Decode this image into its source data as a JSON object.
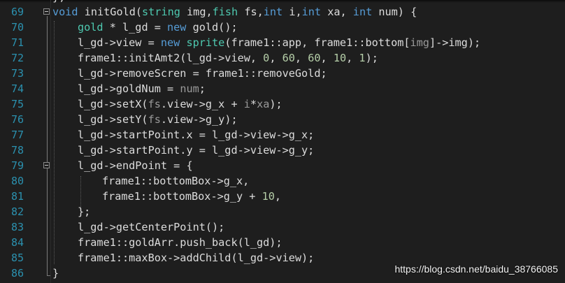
{
  "colors": {
    "background": "#1e1e1e",
    "line_number": "#2b91af",
    "keyword": "#569cd6",
    "type": "#4ec9b0",
    "identifier": "#dcdcdc",
    "parameter": "#9a9a9a",
    "number": "#b5cea8",
    "function": "#dcdcaa"
  },
  "top_fragment": "};",
  "lines": [
    {
      "num": "69",
      "tokens": [
        {
          "t": "void",
          "c": "keyword"
        },
        {
          "t": " initGold(",
          "c": "identifier"
        },
        {
          "t": "string",
          "c": "type"
        },
        {
          "t": " img,",
          "c": "identifier"
        },
        {
          "t": "fish",
          "c": "type"
        },
        {
          "t": " fs,",
          "c": "identifier"
        },
        {
          "t": "int",
          "c": "keyword"
        },
        {
          "t": " i,",
          "c": "identifier"
        },
        {
          "t": "int",
          "c": "keyword"
        },
        {
          "t": " xa, ",
          "c": "identifier"
        },
        {
          "t": "int",
          "c": "keyword"
        },
        {
          "t": " num) {",
          "c": "identifier"
        }
      ]
    },
    {
      "num": "70",
      "tokens": [
        {
          "t": "gold",
          "c": "type"
        },
        {
          "t": " * l_gd = ",
          "c": "identifier"
        },
        {
          "t": "new",
          "c": "keyword"
        },
        {
          "t": " gold();",
          "c": "identifier"
        }
      ]
    },
    {
      "num": "71",
      "tokens": [
        {
          "t": "l_gd->view = ",
          "c": "identifier"
        },
        {
          "t": "new",
          "c": "keyword"
        },
        {
          "t": " ",
          "c": "identifier"
        },
        {
          "t": "sprite",
          "c": "type"
        },
        {
          "t": "(frame1::app, frame1::bottom[",
          "c": "identifier"
        },
        {
          "t": "img",
          "c": "parameter"
        },
        {
          "t": "]->img);",
          "c": "identifier"
        }
      ]
    },
    {
      "num": "72",
      "tokens": [
        {
          "t": "frame1::initAmt2(l_gd->view, ",
          "c": "identifier"
        },
        {
          "t": "0",
          "c": "number"
        },
        {
          "t": ", ",
          "c": "identifier"
        },
        {
          "t": "60",
          "c": "number"
        },
        {
          "t": ", ",
          "c": "identifier"
        },
        {
          "t": "60",
          "c": "number"
        },
        {
          "t": ", ",
          "c": "identifier"
        },
        {
          "t": "10",
          "c": "number"
        },
        {
          "t": ", ",
          "c": "identifier"
        },
        {
          "t": "1",
          "c": "number"
        },
        {
          "t": ");",
          "c": "identifier"
        }
      ]
    },
    {
      "num": "73",
      "tokens": [
        {
          "t": "l_gd->removeScren = frame1::removeGold;",
          "c": "identifier"
        }
      ]
    },
    {
      "num": "74",
      "tokens": [
        {
          "t": "l_gd->goldNum = ",
          "c": "identifier"
        },
        {
          "t": "num",
          "c": "parameter"
        },
        {
          "t": ";",
          "c": "identifier"
        }
      ]
    },
    {
      "num": "75",
      "tokens": [
        {
          "t": "l_gd->setX(",
          "c": "identifier"
        },
        {
          "t": "fs",
          "c": "parameter"
        },
        {
          "t": ".view->g_x + ",
          "c": "identifier"
        },
        {
          "t": "i",
          "c": "parameter"
        },
        {
          "t": "*",
          "c": "identifier"
        },
        {
          "t": "xa",
          "c": "parameter"
        },
        {
          "t": ");",
          "c": "identifier"
        }
      ]
    },
    {
      "num": "76",
      "tokens": [
        {
          "t": "l_gd->setY(",
          "c": "identifier"
        },
        {
          "t": "fs",
          "c": "parameter"
        },
        {
          "t": ".view->g_y);",
          "c": "identifier"
        }
      ]
    },
    {
      "num": "77",
      "tokens": [
        {
          "t": "l_gd->startPoint.x = l_gd->view->g_x;",
          "c": "identifier"
        }
      ]
    },
    {
      "num": "78",
      "tokens": [
        {
          "t": "l_gd->startPoint.y = l_gd->view->g_y;",
          "c": "identifier"
        }
      ]
    },
    {
      "num": "79",
      "tokens": [
        {
          "t": "l_gd->endPoint = {",
          "c": "identifier"
        }
      ]
    },
    {
      "num": "80",
      "tokens": [
        {
          "t": "frame1::bottomBox->g_x,",
          "c": "identifier"
        }
      ]
    },
    {
      "num": "81",
      "tokens": [
        {
          "t": "frame1::bottomBox->g_y + ",
          "c": "identifier"
        },
        {
          "t": "10",
          "c": "number"
        },
        {
          "t": ",",
          "c": "identifier"
        }
      ]
    },
    {
      "num": "82",
      "tokens": [
        {
          "t": "};",
          "c": "identifier"
        }
      ]
    },
    {
      "num": "83",
      "tokens": [
        {
          "t": "l_gd->getCenterPoint();",
          "c": "identifier"
        }
      ]
    },
    {
      "num": "84",
      "tokens": [
        {
          "t": "frame1::goldArr.push_back(l_gd);",
          "c": "identifier"
        }
      ]
    },
    {
      "num": "85",
      "tokens": [
        {
          "t": "frame1::maxBox->addChild(l_gd->view);",
          "c": "identifier"
        }
      ]
    },
    {
      "num": "86",
      "tokens": [
        {
          "t": "}",
          "c": "identifier"
        }
      ]
    }
  ],
  "watermark": "https://blog.csdn.net/baidu_38766085"
}
